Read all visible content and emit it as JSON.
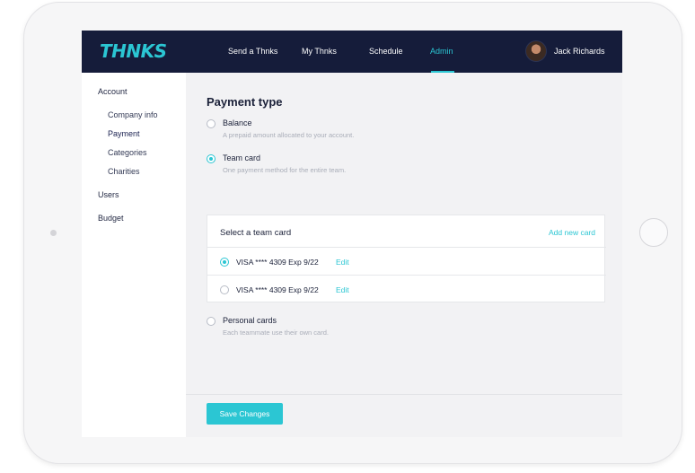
{
  "brand": {
    "logo_text": "THNKS",
    "accent_color": "#2bc6d3",
    "nav_color": "#151c3a"
  },
  "nav": {
    "items": [
      {
        "label": "Send a Thnks"
      },
      {
        "label": "My Thnks"
      },
      {
        "label": "Schedule"
      },
      {
        "label": "Admin",
        "active": true
      }
    ],
    "user_name": "Jack Richards"
  },
  "sidebar": {
    "account": "Account",
    "account_items": [
      {
        "label": "Company info"
      },
      {
        "label": "Payment",
        "active": true
      },
      {
        "label": "Categories"
      },
      {
        "label": "Charities"
      }
    ],
    "users": "Users",
    "budget": "Budget"
  },
  "payment": {
    "title": "Payment type",
    "options": [
      {
        "label": "Balance",
        "description": "A prepaid amount allocated to your account.",
        "selected": false
      },
      {
        "label": "Team card",
        "description": "One payment method for the entire team.",
        "selected": true
      },
      {
        "label": "Personal cards",
        "description": "Each teammate use their own card.",
        "selected": false
      }
    ]
  },
  "team_card": {
    "title": "Select a team card",
    "add_label": "Add new card",
    "cards": [
      {
        "text": "VISA **** 4309  Exp 9/22",
        "edit": "Edit",
        "selected": true
      },
      {
        "text": "VISA **** 4309  Exp 9/22",
        "edit": "Edit",
        "selected": false
      }
    ]
  },
  "footer": {
    "save_label": "Save Changes"
  }
}
